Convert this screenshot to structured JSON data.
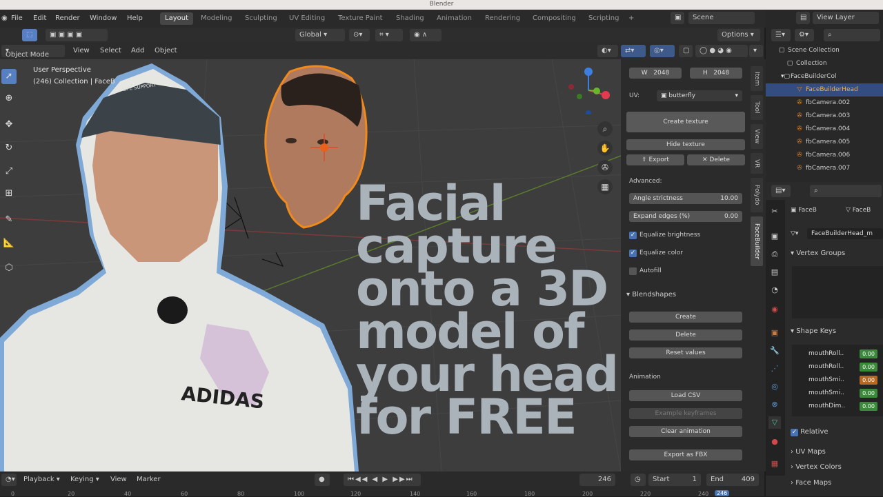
{
  "window": {
    "title": "Blender"
  },
  "menubar": {
    "items": [
      "File",
      "Edit",
      "Render",
      "Window",
      "Help"
    ]
  },
  "workspaces": {
    "tabs": [
      "Layout",
      "Modeling",
      "Sculpting",
      "UV Editing",
      "Texture Paint",
      "Shading",
      "Animation",
      "Rendering",
      "Compositing",
      "Scripting"
    ],
    "active": "Layout",
    "add": "+"
  },
  "scene": {
    "label": "Scene",
    "view_layer": "View Layer"
  },
  "tool_header": {
    "orientation": "Global",
    "options": "Options"
  },
  "viewport_header": {
    "mode": "Object Mode",
    "menus": [
      "View",
      "Select",
      "Add",
      "Object"
    ]
  },
  "viewport": {
    "perspective": "User Perspective",
    "collection": "(246) Collection | FaceB",
    "headline": [
      "Facial",
      "capture",
      "onto a 3D",
      "model of",
      "your head",
      "for FREE"
    ],
    "shirt_text": "ADIDAS",
    "cap_text": "LIFE SUPPORT"
  },
  "npanel": {
    "width_label": "W",
    "width_value": "2048",
    "height_label": "H",
    "height_value": "2048",
    "uv_label": "UV:",
    "uv_value": "butterfly",
    "create_texture": "Create texture",
    "hide_texture": "Hide texture",
    "export": "Export",
    "delete": "Delete",
    "advanced": "Advanced:",
    "angle_strictness_label": "Angle strictness",
    "angle_strictness_value": "10.00",
    "expand_edges_label": "Expand edges (%)",
    "expand_edges_value": "0.00",
    "equalize_brightness": "Equalize brightness",
    "equalize_color": "Equalize color",
    "autofill": "Autofill",
    "blendshapes": "Blendshapes",
    "create": "Create",
    "delete2": "Delete",
    "reset_values": "Reset values",
    "animation": "Animation",
    "load_csv": "Load CSV",
    "example_keyframes": "Example keyframes",
    "clear_animation": "Clear animation",
    "export_fbx": "Export as FBX",
    "tabs": [
      "Item",
      "Tool",
      "View",
      "VR",
      "Polydo",
      "FaceBuilder"
    ]
  },
  "outliner": {
    "rows": [
      "Scene Collection",
      "Collection",
      "FaceBuilderCol",
      "FaceBuilderHead",
      "fbCamera.002",
      "fbCamera.003",
      "fbCamera.004",
      "fbCamera.005",
      "fbCamera.006",
      "fbCamera.007"
    ]
  },
  "properties": {
    "object": "FaceB",
    "mesh": "FaceB",
    "mesh_data": "FaceBuilderHead_m",
    "vertex_groups": "Vertex Groups",
    "shape_keys": "Shape Keys",
    "shape_key_rows": [
      {
        "name": "mouthRoll..",
        "value": "0.00"
      },
      {
        "name": "mouthRoll..",
        "value": "0.00"
      },
      {
        "name": "mouthSmi..",
        "value": "0.00"
      },
      {
        "name": "mouthSmi..",
        "value": "0.00"
      },
      {
        "name": "mouthDim..",
        "value": "0.00"
      }
    ],
    "relative": "Relative",
    "uv_maps": "UV Maps",
    "vertex_colors": "Vertex Colors",
    "face_maps": "Face Maps"
  },
  "timeline": {
    "playback": "Playback",
    "keying": "Keying",
    "view": "View",
    "marker": "Marker",
    "current_frame": "246",
    "start_label": "Start",
    "start_value": "1",
    "end_label": "End",
    "end_value": "409",
    "ticks": [
      "0",
      "20",
      "40",
      "60",
      "80",
      "100",
      "120",
      "140",
      "160",
      "180",
      "200",
      "220",
      "240"
    ],
    "playhead": "246"
  },
  "colors": {
    "accent": "#4772b3",
    "selection": "#ffaf29",
    "headline": "#aab3ba",
    "outline": "#7fa9d6"
  }
}
